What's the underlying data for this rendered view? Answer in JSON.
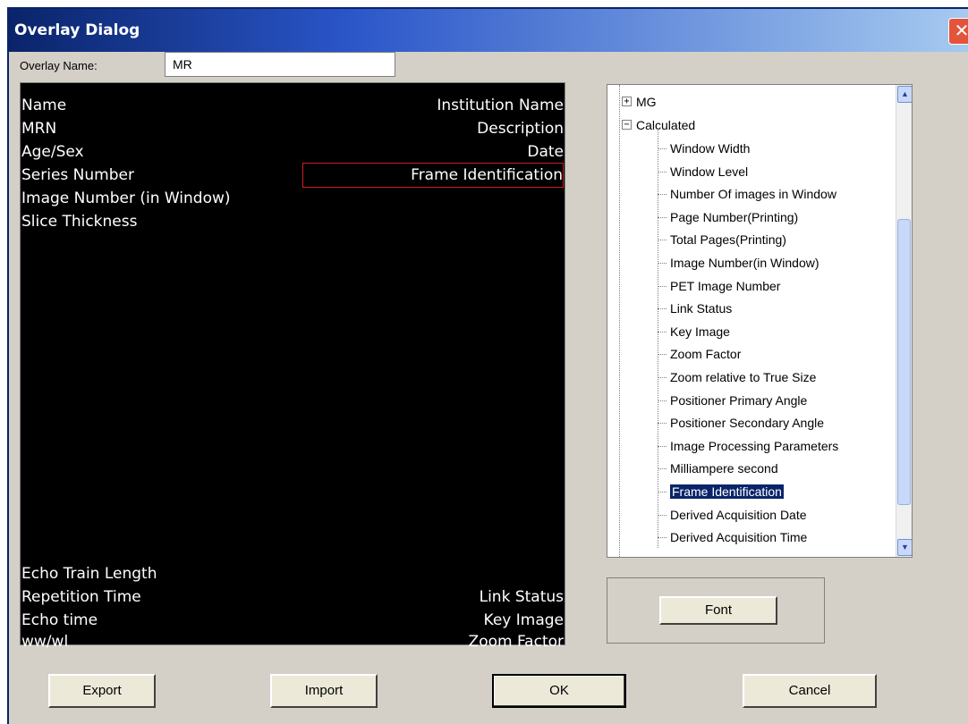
{
  "window": {
    "title": "Overlay Dialog",
    "close_glyph": "✕"
  },
  "overlay_name": {
    "label": "Overlay Name:",
    "value": "MR"
  },
  "preview": {
    "top_left": [
      "Name",
      "MRN",
      "Age/Sex",
      "Series Number",
      "Image Number (in Window)",
      "Slice Thickness"
    ],
    "top_right": [
      "Institution Name",
      "Description",
      "Date",
      "Frame Identification"
    ],
    "bottom_left": [
      "Echo Train Length",
      "Repetition Time",
      "Echo time",
      "ww/wl"
    ],
    "bottom_right": [
      "Link Status",
      "Key Image",
      "Zoom Factor"
    ],
    "selected_item": "Frame Identification"
  },
  "tree": {
    "nodes": [
      {
        "label": "MG",
        "expander": "+"
      },
      {
        "label": "Calculated",
        "expander": "−"
      }
    ],
    "children": [
      "Window Width",
      "Window Level",
      "Number Of images in Window",
      "Page Number(Printing)",
      "Total Pages(Printing)",
      "Image Number(in Window)",
      "PET Image Number",
      "Link Status",
      "Key Image",
      "Zoom Factor",
      "Zoom relative to True Size",
      "Positioner Primary Angle",
      "Positioner Secondary Angle",
      "Image Processing Parameters",
      "Milliampere second",
      "Frame Identification",
      "Derived Acquisition Date",
      "Derived Acquisition Time"
    ],
    "selected": "Frame Identification",
    "scroll_up_icon": "▲",
    "scroll_down_icon": "▼"
  },
  "buttons": {
    "font": "Font",
    "export": "Export",
    "import": "Import",
    "ok": "OK",
    "cancel": "Cancel"
  },
  "colors": {
    "title_start": "#0a246a",
    "title_end": "#a6caf0",
    "selection": "#0a246a",
    "preview_bg": "#000000",
    "dialog_bg": "#d4d0c8"
  }
}
